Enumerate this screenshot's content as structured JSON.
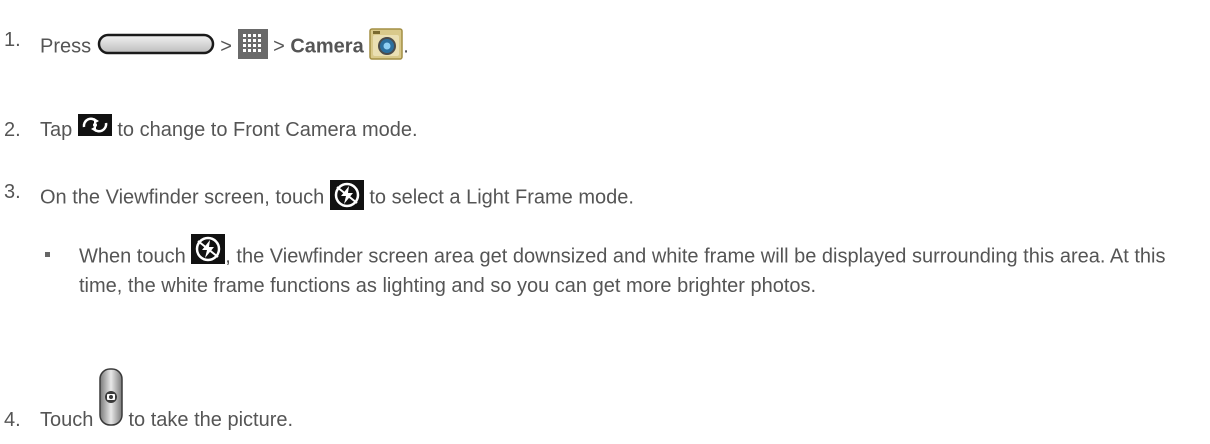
{
  "steps": [
    {
      "number": "1.",
      "parts": {
        "press": "Press",
        "sep1": ">",
        "sep2": ">",
        "target": "Camera",
        "end": "."
      },
      "icons": [
        "home-key-icon",
        "apps-grid-icon",
        "camera-app-icon"
      ]
    },
    {
      "number": "2.",
      "parts": {
        "lead": "Tap",
        "rest": "to change to Front Camera mode."
      },
      "icons": [
        "switch-camera-icon"
      ]
    },
    {
      "number": "3.",
      "parts": {
        "lead": "On the Viewfinder screen, touch",
        "rest": "to select a Light Frame mode."
      },
      "icons": [
        "light-frame-icon"
      ]
    },
    {
      "number": "4.",
      "parts": {
        "lead": "Touch",
        "rest": "to take the picture."
      },
      "icons": [
        "shutter-button-icon"
      ]
    }
  ],
  "bullet": {
    "lead": "When touch",
    "rest": ", the Viewfinder screen area get downsized and white frame will be displayed surrounding this area. At this time, the white frame functions as lighting and so you can get more brighter photos.",
    "icons": [
      "light-frame-icon"
    ]
  },
  "colors": {
    "text": "#555555",
    "icon_dark": "#111111"
  }
}
